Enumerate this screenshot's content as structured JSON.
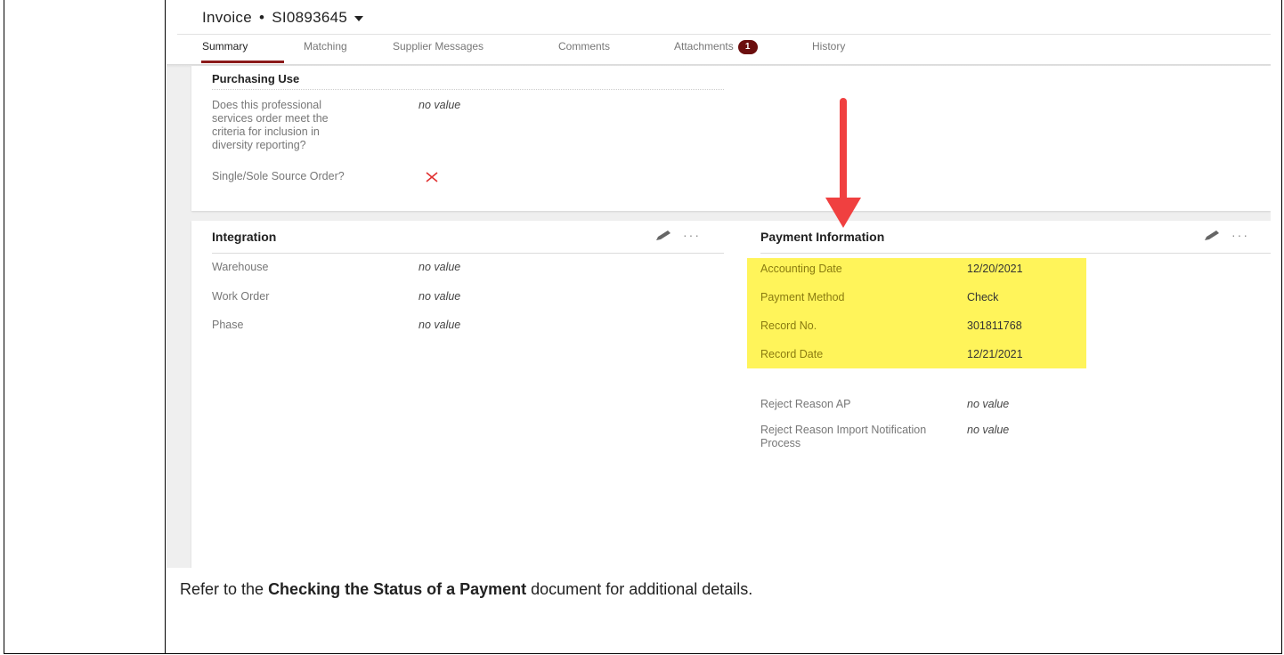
{
  "header": {
    "title_prefix": "Invoice",
    "dot": "•",
    "invoice_number": "SI0893645"
  },
  "tabs": [
    {
      "label": "Summary",
      "active": true
    },
    {
      "label": "Matching"
    },
    {
      "label": "Supplier Messages"
    },
    {
      "label": "Comments"
    },
    {
      "label": "Attachments",
      "badge": "1"
    },
    {
      "label": "History"
    }
  ],
  "purchasing": {
    "title": "Purchasing Use",
    "fields": [
      {
        "label": "Does this professional services order meet the criteria for inclusion in diversity reporting?",
        "value": "no value"
      },
      {
        "label": "Single/Sole Source Order?",
        "icon": "x-icon"
      }
    ]
  },
  "integration": {
    "title": "Integration",
    "fields": [
      {
        "label": "Warehouse",
        "value": "no value"
      },
      {
        "label": "Work Order",
        "value": "no value"
      },
      {
        "label": "Phase",
        "value": "no value"
      }
    ]
  },
  "payment": {
    "title": "Payment Information",
    "highlighted": [
      {
        "label": "Accounting Date",
        "value": "12/20/2021"
      },
      {
        "label": "Payment Method",
        "value": "Check"
      },
      {
        "label": "Record No.",
        "value": "301811768"
      },
      {
        "label": "Record Date",
        "value": "12/21/2021"
      }
    ],
    "other": [
      {
        "label": "Reject Reason AP",
        "value": "no value"
      },
      {
        "label": "Reject Reason Import Notification Process",
        "value": "no value"
      }
    ]
  },
  "caption": {
    "pre": "Refer to the ",
    "bold": "Checking the Status of a Payment",
    "post": " document for additional details."
  },
  "colors": {
    "accent": "#8b1a1a",
    "badge": "#6b0e0e",
    "highlight": "#fff45a",
    "arrow": "#f04040",
    "x_icon": "#e03030"
  }
}
